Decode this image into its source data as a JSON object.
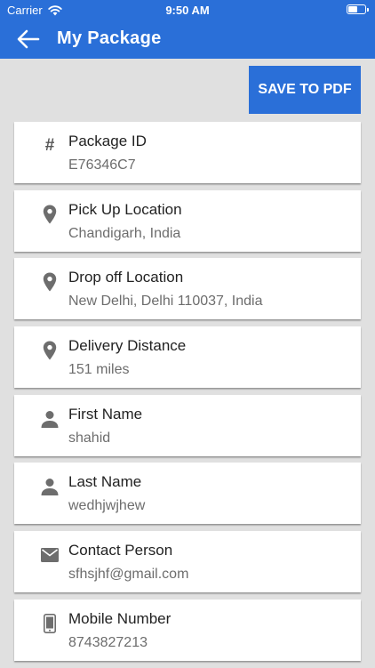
{
  "status_bar": {
    "carrier": "Carrier",
    "time": "9:50 AM",
    "battery_level": 0.6
  },
  "header": {
    "title": "My Package"
  },
  "actions": {
    "save_pdf_label": "SAVE TO PDF"
  },
  "colors": {
    "primary": "#2a6fd8",
    "background": "#e0e0e0",
    "icon": "#6d6d6d"
  },
  "details": [
    {
      "icon": "hash-icon",
      "label": "Package ID",
      "value": "E76346C7"
    },
    {
      "icon": "location-pin-icon",
      "label": "Pick Up Location",
      "value": "Chandigarh, India"
    },
    {
      "icon": "location-pin-icon",
      "label": "Drop off Location",
      "value": "New Delhi, Delhi 110037, India"
    },
    {
      "icon": "location-pin-icon",
      "label": "Delivery Distance",
      "value": "151 miles"
    },
    {
      "icon": "person-icon",
      "label": "First Name",
      "value": "shahid"
    },
    {
      "icon": "person-icon",
      "label": "Last Name",
      "value": "wedhjwjhew"
    },
    {
      "icon": "envelope-icon",
      "label": "Contact Person",
      "value": "sfhsjhf@gmail.com"
    },
    {
      "icon": "mobile-phone-icon",
      "label": "Mobile Number",
      "value": "8743827213"
    }
  ]
}
